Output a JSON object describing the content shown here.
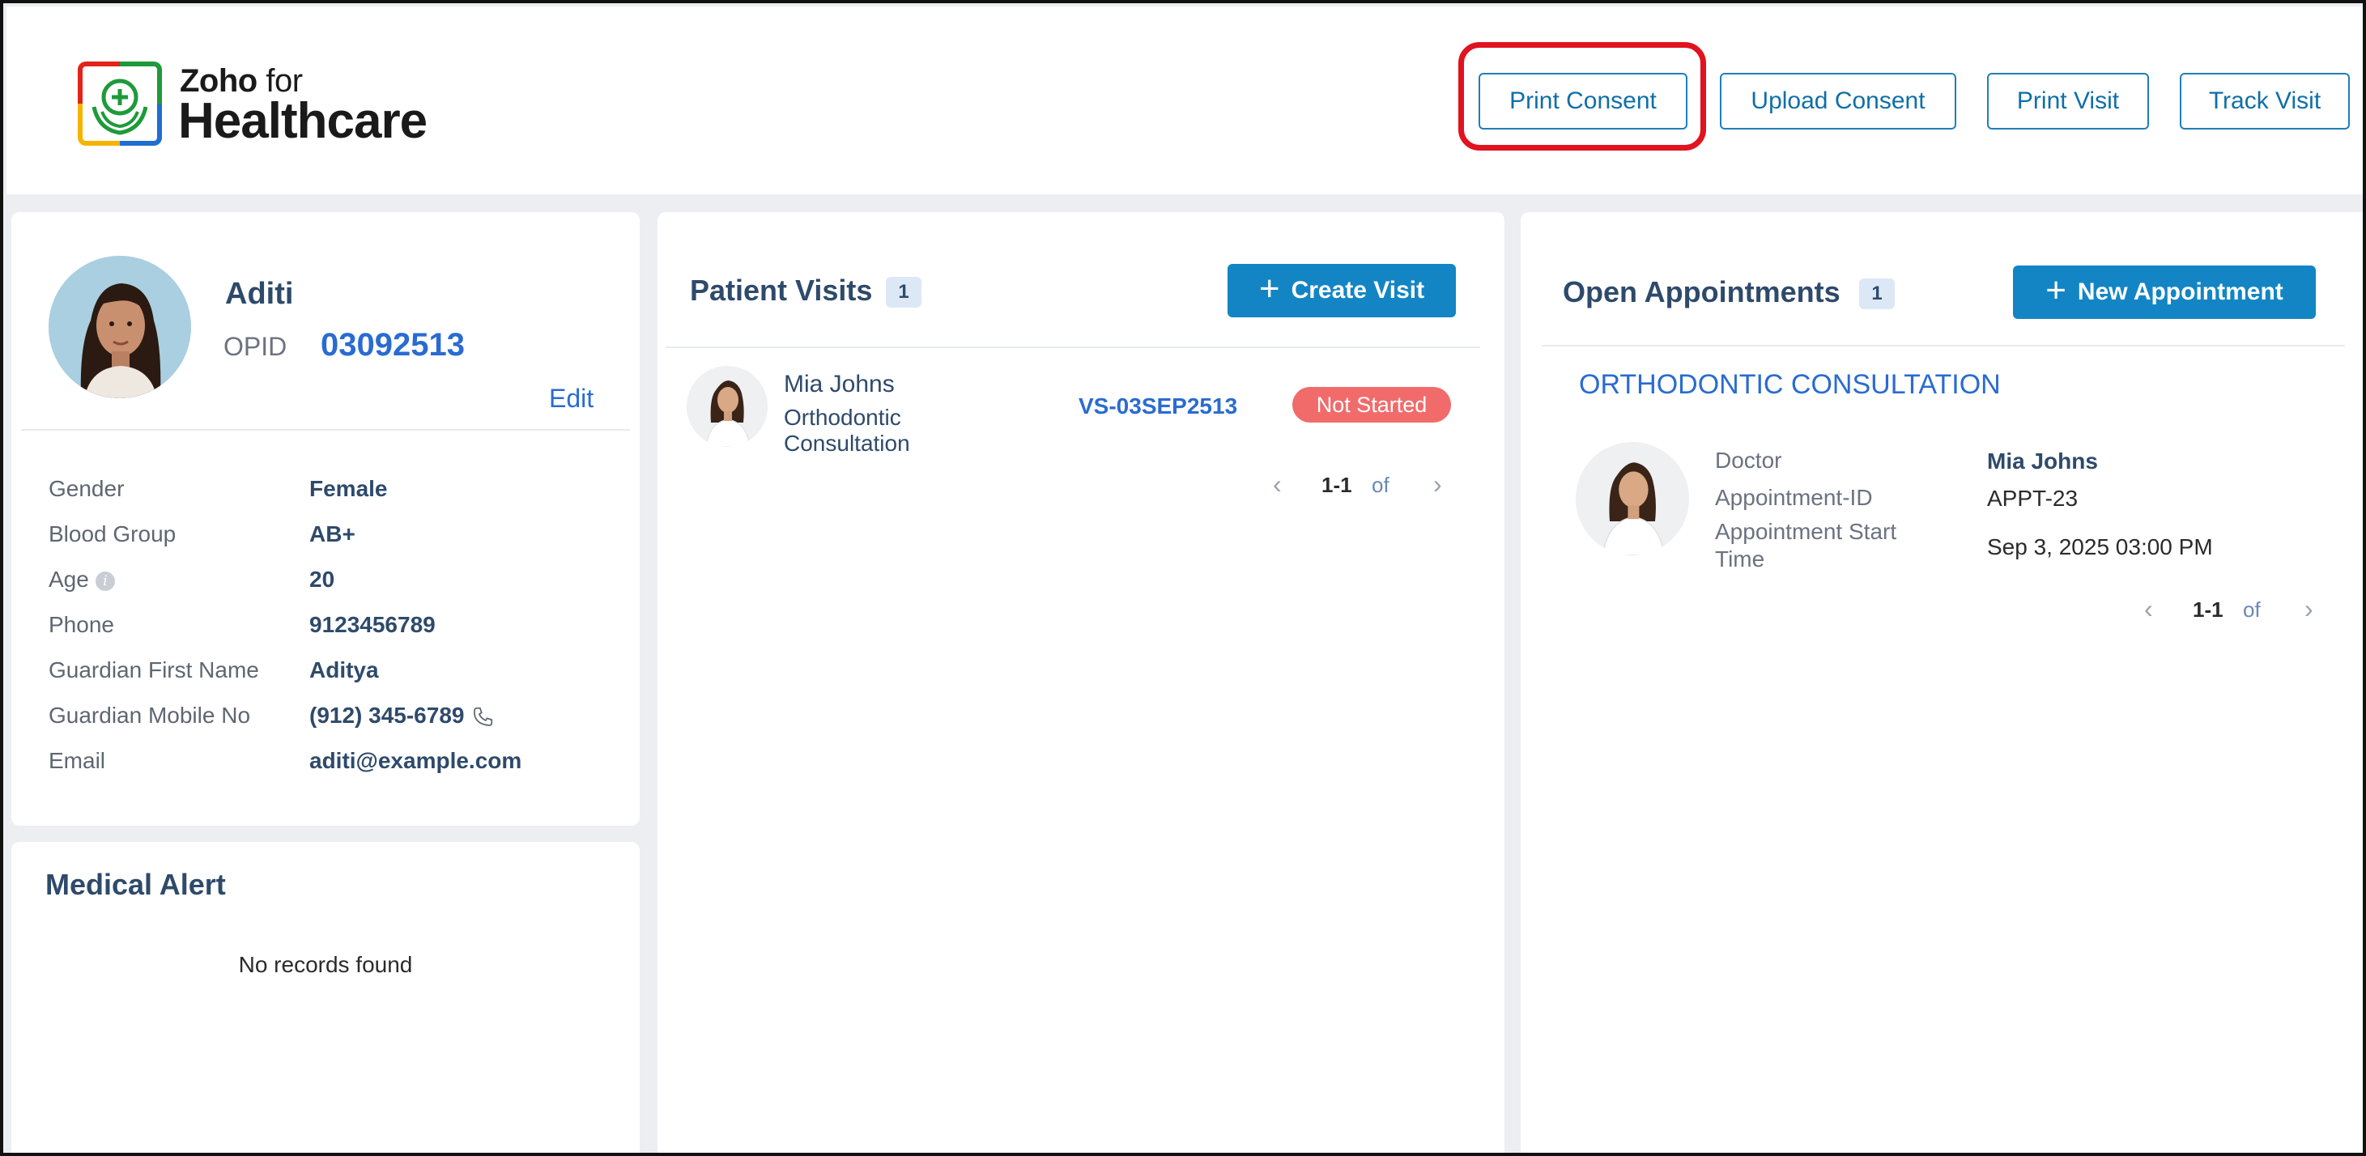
{
  "brand": {
    "zoho": "Zoho",
    "for": "for",
    "healthcare": "Healthcare"
  },
  "header_actions": {
    "print_consent": "Print Consent",
    "upload_consent": "Upload Consent",
    "print_visit": "Print Visit",
    "track_visit": "Track Visit"
  },
  "colors": {
    "primary": "#1385c4",
    "link": "#2a6bd1",
    "heading": "#2e4a6b",
    "status_not_started": "#f16b6b",
    "highlight": "#e0131f"
  },
  "patient": {
    "name": "Aditi",
    "opid_label": "OPID",
    "opid": "03092513",
    "edit_label": "Edit",
    "fields": [
      {
        "label": "Gender",
        "value": "Female"
      },
      {
        "label": "Blood Group",
        "value": "AB+"
      },
      {
        "label": "Age",
        "value": "20"
      },
      {
        "label": "Phone",
        "value": "9123456789"
      },
      {
        "label": "Guardian First Name",
        "value": "Aditya"
      },
      {
        "label": "Guardian Mobile No",
        "value": "(912) 345-6789"
      },
      {
        "label": "Email",
        "value": "aditi@example.com"
      }
    ]
  },
  "medical_alert": {
    "title": "Medical Alert",
    "empty_text": "No records found"
  },
  "patient_visits": {
    "title": "Patient Visits",
    "count": "1",
    "create_label": "Create Visit",
    "items": [
      {
        "doctor": "Mia Johns",
        "type_line1": "Orthodontic",
        "type_line2": "Consultation",
        "visit_id": "VS-03SEP2513",
        "status": "Not Started"
      }
    ],
    "pager": {
      "range": "1-1",
      "of": "of"
    }
  },
  "open_appointments": {
    "title": "Open Appointments",
    "count": "1",
    "new_label": "New Appointment",
    "items": [
      {
        "title": "ORTHODONTIC CONSULTATION",
        "doctor_label": "Doctor",
        "doctor": "Mia Johns",
        "id_label": "Appointment-ID",
        "id": "APPT-23",
        "start_label_line1": "Appointment Start",
        "start_label_line2": "Time",
        "start": "Sep 3, 2025 03:00 PM"
      }
    ],
    "pager": {
      "range": "1-1",
      "of": "of"
    }
  },
  "icons": [
    "healthcare-logo-icon",
    "info-icon",
    "phone-icon",
    "plus-icon",
    "chevron-left-icon",
    "chevron-right-icon"
  ]
}
